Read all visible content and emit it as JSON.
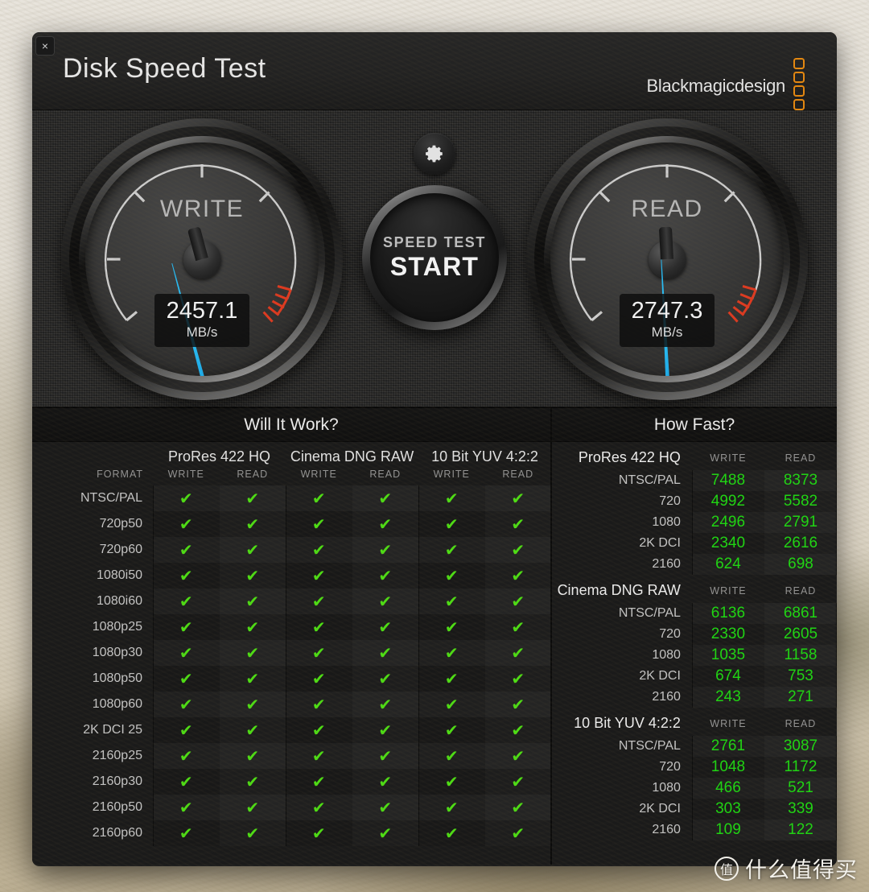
{
  "window": {
    "title": "Disk Speed Test",
    "close_label": "×",
    "brand_text": "Blackmagicdesign",
    "brand_squares": 4,
    "accent_orange": "#e8890f"
  },
  "gauges": {
    "gear_icon": "gear-icon",
    "start_button": {
      "sub_label": "SPEED TEST",
      "main_label": "START"
    },
    "write": {
      "label": "WRITE",
      "value": "2457.1",
      "unit": "MB/s",
      "needle_angle_deg": -15,
      "needle_color": "#29bcf2"
    },
    "read": {
      "label": "READ",
      "value": "2747.3",
      "unit": "MB/s",
      "needle_angle_deg": -3,
      "needle_color": "#29bcf2"
    }
  },
  "will_it_work": {
    "panel_title": "Will It Work?",
    "format_header": "FORMAT",
    "codec_groups": [
      "ProRes 422 HQ",
      "Cinema DNG RAW",
      "10 Bit YUV 4:2:2"
    ],
    "sub_headers": [
      "WRITE",
      "READ"
    ],
    "check_mark": "✔",
    "check_color": "#4ede14",
    "rows": [
      {
        "format": "NTSC/PAL",
        "cells": [
          true,
          true,
          true,
          true,
          true,
          true
        ]
      },
      {
        "format": "720p50",
        "cells": [
          true,
          true,
          true,
          true,
          true,
          true
        ]
      },
      {
        "format": "720p60",
        "cells": [
          true,
          true,
          true,
          true,
          true,
          true
        ]
      },
      {
        "format": "1080i50",
        "cells": [
          true,
          true,
          true,
          true,
          true,
          true
        ]
      },
      {
        "format": "1080i60",
        "cells": [
          true,
          true,
          true,
          true,
          true,
          true
        ]
      },
      {
        "format": "1080p25",
        "cells": [
          true,
          true,
          true,
          true,
          true,
          true
        ]
      },
      {
        "format": "1080p30",
        "cells": [
          true,
          true,
          true,
          true,
          true,
          true
        ]
      },
      {
        "format": "1080p50",
        "cells": [
          true,
          true,
          true,
          true,
          true,
          true
        ]
      },
      {
        "format": "1080p60",
        "cells": [
          true,
          true,
          true,
          true,
          true,
          true
        ]
      },
      {
        "format": "2K DCI 25",
        "cells": [
          true,
          true,
          true,
          true,
          true,
          true
        ]
      },
      {
        "format": "2160p25",
        "cells": [
          true,
          true,
          true,
          true,
          true,
          true
        ]
      },
      {
        "format": "2160p30",
        "cells": [
          true,
          true,
          true,
          true,
          true,
          true
        ]
      },
      {
        "format": "2160p50",
        "cells": [
          true,
          true,
          true,
          true,
          true,
          true
        ]
      },
      {
        "format": "2160p60",
        "cells": [
          true,
          true,
          true,
          true,
          true,
          true
        ]
      }
    ]
  },
  "how_fast": {
    "panel_title": "How Fast?",
    "sub_headers": [
      "WRITE",
      "READ"
    ],
    "value_color": "#1ed812",
    "groups": [
      {
        "name": "ProRes 422 HQ",
        "rows": [
          {
            "label": "NTSC/PAL",
            "write": "7488",
            "read": "8373"
          },
          {
            "label": "720",
            "write": "4992",
            "read": "5582"
          },
          {
            "label": "1080",
            "write": "2496",
            "read": "2791"
          },
          {
            "label": "2K DCI",
            "write": "2340",
            "read": "2616"
          },
          {
            "label": "2160",
            "write": "624",
            "read": "698"
          }
        ]
      },
      {
        "name": "Cinema DNG RAW",
        "rows": [
          {
            "label": "NTSC/PAL",
            "write": "6136",
            "read": "6861"
          },
          {
            "label": "720",
            "write": "2330",
            "read": "2605"
          },
          {
            "label": "1080",
            "write": "1035",
            "read": "1158"
          },
          {
            "label": "2K DCI",
            "write": "674",
            "read": "753"
          },
          {
            "label": "2160",
            "write": "243",
            "read": "271"
          }
        ]
      },
      {
        "name": "10 Bit YUV 4:2:2",
        "rows": [
          {
            "label": "NTSC/PAL",
            "write": "2761",
            "read": "3087"
          },
          {
            "label": "720",
            "write": "1048",
            "read": "1172"
          },
          {
            "label": "1080",
            "write": "466",
            "read": "521"
          },
          {
            "label": "2K DCI",
            "write": "303",
            "read": "339"
          },
          {
            "label": "2160",
            "write": "109",
            "read": "122"
          }
        ]
      }
    ]
  },
  "watermark": {
    "logo_glyph": "值",
    "text": "什么值得买"
  }
}
